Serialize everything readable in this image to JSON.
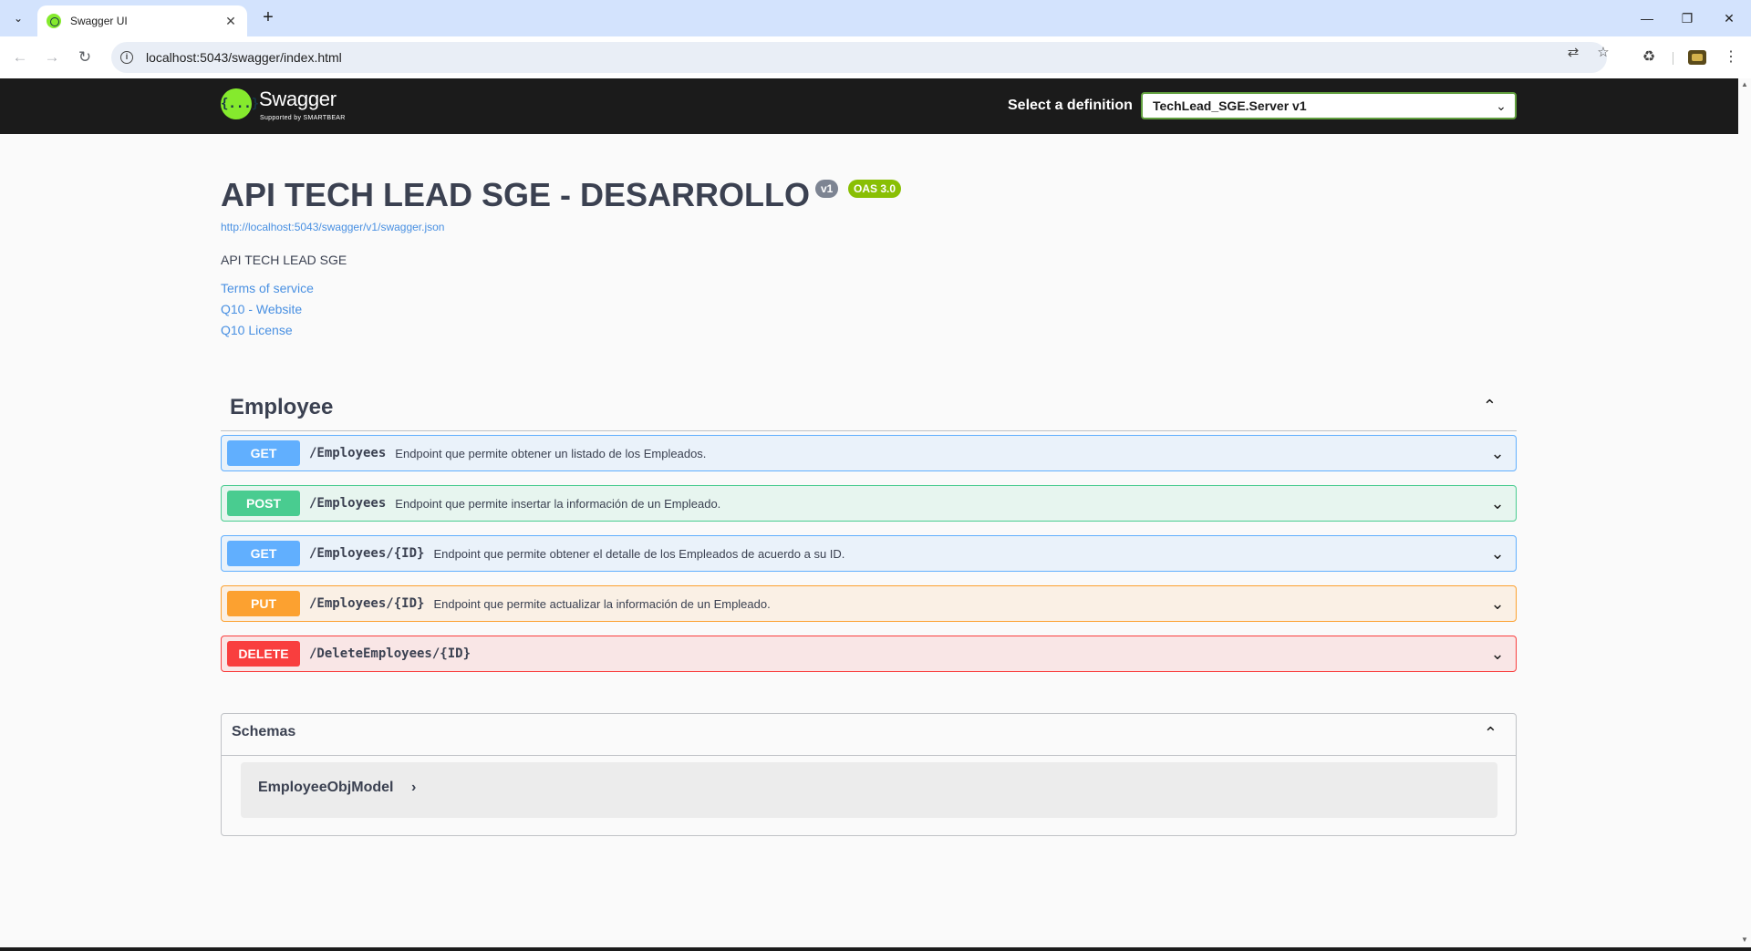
{
  "browser": {
    "tab_title": "Swagger UI",
    "url": "localhost:5043/swagger/index.html"
  },
  "topbar": {
    "logo_text": "Swagger",
    "logo_subtext": "Supported by SMARTBEAR",
    "logo_mark": "{...}",
    "select_label": "Select a definition",
    "definition_selected": "TechLead_SGE.Server v1"
  },
  "info": {
    "title": "API TECH LEAD SGE - DESARROLLO",
    "version_badge": "v1",
    "oas_badge": "OAS 3.0",
    "spec_url": "http://localhost:5043/swagger/v1/swagger.json",
    "description": "API TECH LEAD SGE",
    "links": [
      "Terms of service",
      "Q10 - Website",
      "Q10 License"
    ]
  },
  "tag": {
    "name": "Employee"
  },
  "operations": [
    {
      "method": "GET",
      "path": "/Employees",
      "summary": "Endpoint que permite obtener un listado de los Empleados."
    },
    {
      "method": "POST",
      "path": "/Employees",
      "summary": "Endpoint que permite insertar la información de un Empleado."
    },
    {
      "method": "GET",
      "path": "/Employees/{ID}",
      "summary": "Endpoint que permite obtener el detalle de los Empleados de acuerdo a su ID."
    },
    {
      "method": "PUT",
      "path": "/Employees/{ID}",
      "summary": "Endpoint que permite actualizar la información de un Empleado."
    },
    {
      "method": "DELETE",
      "path": "/DeleteEmployees/{ID}",
      "summary": ""
    }
  ],
  "schemas": {
    "title": "Schemas",
    "models": [
      "EmployeeObjModel"
    ]
  },
  "colors": {
    "get": "#61affe",
    "post": "#49cc90",
    "put": "#fca130",
    "delete": "#f93e3e",
    "topbar": "#1b1b1b",
    "link": "#4990e2"
  }
}
